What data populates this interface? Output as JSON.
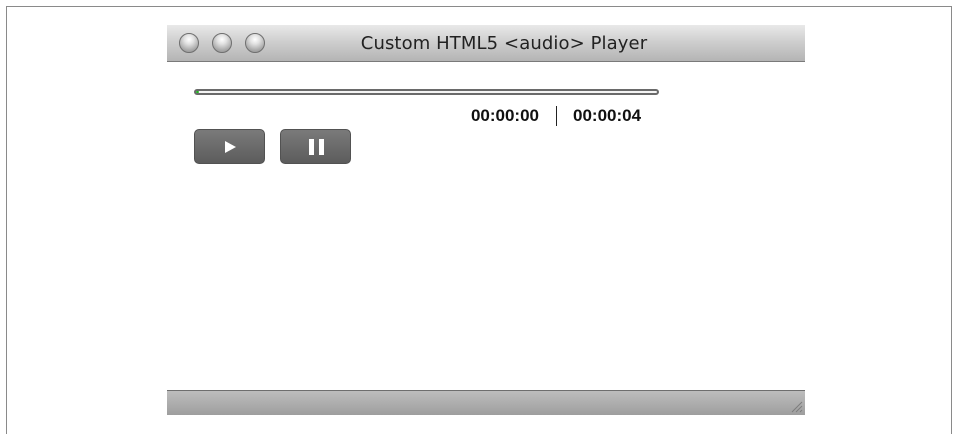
{
  "window": {
    "title": "Custom HTML5 <audio> Player"
  },
  "player": {
    "progress_fraction": 0.0,
    "current_time": "00:00:00",
    "duration": "00:00:04",
    "play_icon": "play-icon",
    "pause_icon": "pause-icon"
  },
  "colors": {
    "progress_fill": "#22b522",
    "button": "#666666"
  }
}
